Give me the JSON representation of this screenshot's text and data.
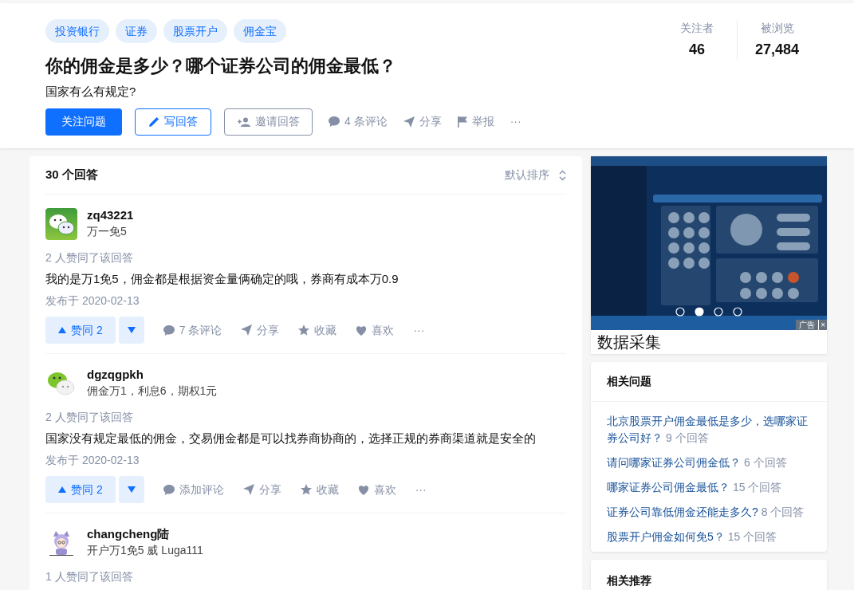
{
  "question": {
    "topics": [
      "投资银行",
      "证券",
      "股票开户",
      "佣金宝"
    ],
    "title": "你的佣金是多少？哪个证券公司的佣金最低？",
    "detail": "国家有么有规定?",
    "actions": {
      "follow": "关注问题",
      "write": "写回答",
      "invite": "邀请回答",
      "comments": "4 条评论",
      "share": "分享",
      "report": "举报",
      "more": "···"
    },
    "stats": [
      {
        "label": "关注者",
        "value": "46"
      },
      {
        "label": "被浏览",
        "value": "27,484"
      }
    ]
  },
  "answers": {
    "count": "30 个回答",
    "sort": "默认排序",
    "items": [
      {
        "author": "zq43221",
        "bio": "万一免5",
        "avatar": {
          "kind": "chat-square"
        },
        "voters": "2 人赞同了该回答",
        "content": "我的是万1免5，佣金都是根据资金量俩确定的哦，券商有成本万0.9",
        "date": "发布于 2020-02-13",
        "actions": {
          "vote": "赞同 2",
          "comment": "7 条评论",
          "share": "分享",
          "collect": "收藏",
          "like": "喜欢",
          "more": "···"
        }
      },
      {
        "author": "dgzqgpkh",
        "bio": "佣金万1，利息6，期权1元",
        "avatar": {
          "kind": "chat-plain"
        },
        "voters": "2 人赞同了该回答",
        "content": "国家没有规定最低的佣金，交易佣金都是可以找券商协商的，选择正规的券商渠道就是安全的",
        "date": "发布于 2020-02-13",
        "actions": {
          "vote": "赞同 2",
          "comment": "添加评论",
          "share": "分享",
          "collect": "收藏",
          "like": "喜欢",
          "more": "···"
        }
      },
      {
        "author": "changcheng陆",
        "bio": "开户万1免5 威 Luga111",
        "avatar": {
          "kind": "cartoon"
        },
        "voters": "1 人赞同了该回答"
      }
    ]
  },
  "sidebar": {
    "ad": {
      "caption": "数据采集",
      "label": "广告",
      "close": "×"
    },
    "related": {
      "title": "相关问题",
      "items": [
        {
          "question": "北京股票开户佣金最低是多少，选哪家证券公司好？",
          "answers": "9 个回答"
        },
        {
          "question": "请问哪家证券公司佣金低？",
          "answers": "6 个回答"
        },
        {
          "question": "哪家证券公司佣金最低？",
          "answers": "15 个回答"
        },
        {
          "question": "证券公司靠低佣金还能走多久?",
          "answers": "8 个回答"
        },
        {
          "question": "股票开户佣金如何免5？",
          "answers": "15 个回答"
        }
      ]
    },
    "recommend": {
      "title": "相关推荐"
    }
  }
}
